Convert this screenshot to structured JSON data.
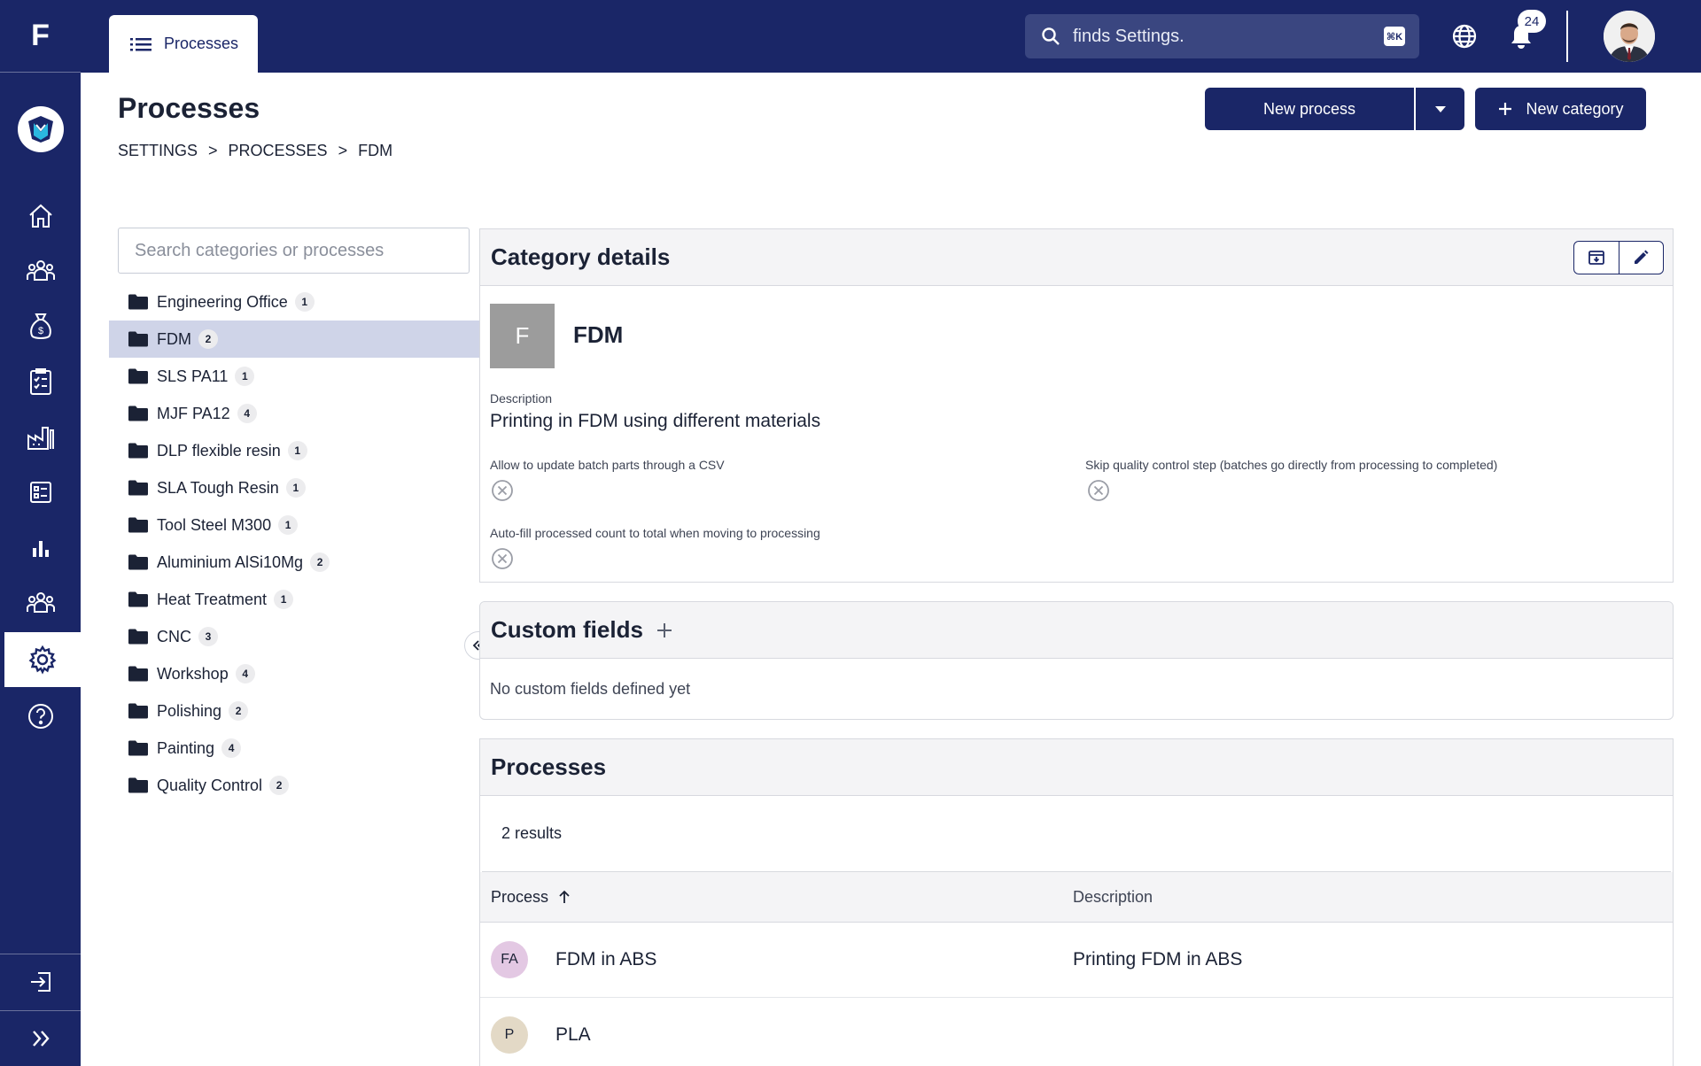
{
  "app": {
    "logo_letter": "F",
    "org_logo": "shield-logo"
  },
  "rail": {
    "items": [
      {
        "name": "home-icon"
      },
      {
        "name": "team-icon"
      },
      {
        "name": "money-bag-icon"
      },
      {
        "name": "checklist-icon"
      },
      {
        "name": "factory-icon"
      },
      {
        "name": "list-icon"
      },
      {
        "name": "bar-chart-icon"
      },
      {
        "name": "users-icon"
      },
      {
        "name": "gear-icon",
        "active": true
      },
      {
        "name": "help-icon"
      }
    ],
    "bottom": [
      {
        "name": "logout-icon"
      },
      {
        "name": "expand-icon"
      }
    ]
  },
  "topbar": {
    "tab_label": "Processes",
    "search_placeholder": "finds Settings.",
    "search_shortcut": "⌘K",
    "notifications_count": "24"
  },
  "header": {
    "title": "Processes",
    "breadcrumb": [
      "SETTINGS",
      "PROCESSES",
      "FDM"
    ],
    "new_process_label": "New process",
    "new_category_label": "New category"
  },
  "tree": {
    "search_placeholder": "Search categories or processes",
    "items": [
      {
        "label": "Engineering Office",
        "count": "1"
      },
      {
        "label": "FDM",
        "count": "2",
        "selected": true
      },
      {
        "label": "SLS PA11",
        "count": "1"
      },
      {
        "label": "MJF PA12",
        "count": "4"
      },
      {
        "label": "DLP flexible resin",
        "count": "1"
      },
      {
        "label": "SLA Tough Resin",
        "count": "1"
      },
      {
        "label": "Tool Steel M300",
        "count": "1"
      },
      {
        "label": "Aluminium AlSi10Mg",
        "count": "2"
      },
      {
        "label": "Heat Treatment",
        "count": "1"
      },
      {
        "label": "CNC",
        "count": "3"
      },
      {
        "label": "Workshop",
        "count": "4"
      },
      {
        "label": "Polishing",
        "count": "2"
      },
      {
        "label": "Painting",
        "count": "4"
      },
      {
        "label": "Quality Control",
        "count": "2"
      }
    ]
  },
  "category": {
    "panel_title": "Category details",
    "avatar_letter": "F",
    "name": "FDM",
    "description_label": "Description",
    "description": "Printing in FDM using different materials",
    "option_csv": "Allow to update batch parts through a CSV",
    "option_skip_qc": "Skip quality control step (batches go directly from processing to completed)",
    "option_autofill": "Auto-fill processed count to total when moving to processing"
  },
  "custom_fields": {
    "title": "Custom fields",
    "empty": "No custom fields defined yet"
  },
  "processes": {
    "title": "Processes",
    "results": "2 results",
    "col_process": "Process",
    "col_description": "Description",
    "rows": [
      {
        "initials": "FA",
        "name": "FDM in ABS",
        "description": "Printing FDM in ABS",
        "color": "#e3c8e3"
      },
      {
        "initials": "P",
        "name": "PLA",
        "description": "",
        "color": "#e3d9c6"
      }
    ]
  },
  "colors": {
    "brand": "#1a2667",
    "selected_row": "#cfd4e8"
  }
}
